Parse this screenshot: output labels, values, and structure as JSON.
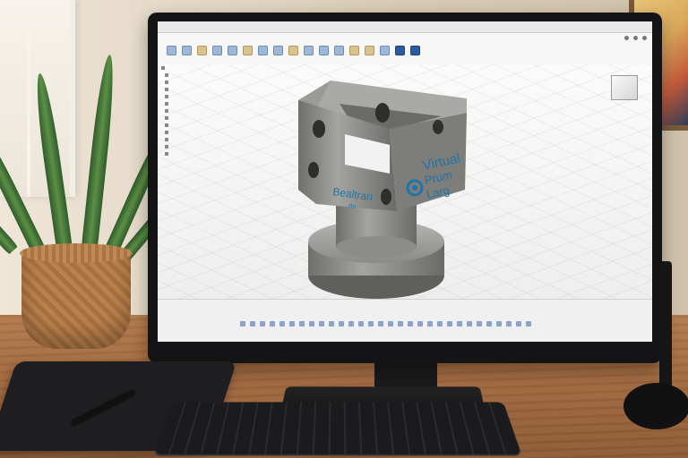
{
  "scene": {
    "description_domain": "photo of a CAD workstation on a wooden desk"
  },
  "app": {
    "topbar_title": "",
    "toolbar_search_label": "",
    "tabs": [
      "",
      "",
      "",
      "",
      "",
      ""
    ],
    "viewcube_label": "",
    "comments_label": ""
  },
  "browser": {
    "title": "",
    "items": [
      "",
      "",
      "",
      "",
      "",
      "",
      "",
      "",
      "",
      "",
      "",
      ""
    ]
  },
  "part": {
    "front_logo_line1": "Virtual",
    "front_logo_line2": "Prum",
    "front_logo_line3": "Larg",
    "side_logo": "Bealtrari",
    "side_logo_sub": "rtn",
    "body_color": "#8d8d8a",
    "logo_color": "#1f74a8"
  },
  "colors": {
    "desk": "#a36a3f",
    "wall": "#e7dccb",
    "monitor_bezel": "#141416",
    "accent_blue": "#2b5c9e"
  }
}
